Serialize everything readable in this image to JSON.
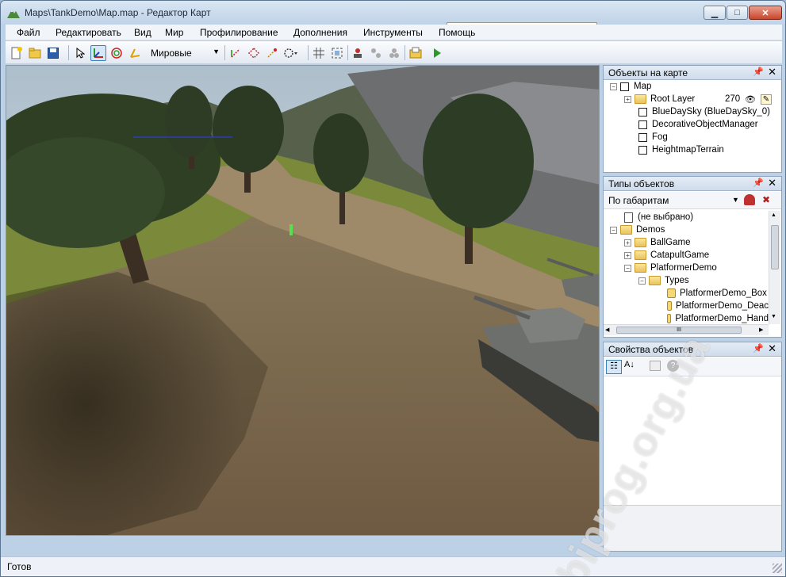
{
  "window": {
    "title": "Maps\\TankDemo\\Map.map - Редактор Карт",
    "minimize_glyph": "▁",
    "maximize_glyph": "□",
    "close_glyph": "✕"
  },
  "menu": [
    "Файл",
    "Редактировать",
    "Вид",
    "Мир",
    "Профилирование",
    "Дополнения",
    "Инструменты",
    "Помощь"
  ],
  "toolbar": {
    "coord_mode": "Мировые",
    "icons": [
      "new-file-icon",
      "open-folder-icon",
      "save-icon",
      "select-arrow-icon",
      "move-gizmo-icon",
      "rotate-gizmo-icon",
      "scale-gizmo-icon",
      "snap-move-icon",
      "snap-rotate-icon",
      "snap-scale-icon",
      "snap-align-icon",
      "grid-icon",
      "focus-icon",
      "create-object-icon",
      "clone-icon",
      "group-icon",
      "properties-icon",
      "play-icon"
    ]
  },
  "objects_panel": {
    "title": "Объекты на карте",
    "items": [
      {
        "label": "Map"
      },
      {
        "label": "Root Layer",
        "count": "270"
      },
      {
        "label": "BlueDaySky (BlueDaySky_0)"
      },
      {
        "label": "DecorativeObjectManager"
      },
      {
        "label": "Fog"
      },
      {
        "label": "HeightmapTerrain"
      }
    ]
  },
  "types_panel": {
    "title": "Типы объектов",
    "filter": "По габаритам",
    "items": [
      {
        "label": "(не выбрано)"
      },
      {
        "label": "Demos"
      },
      {
        "label": "BallGame"
      },
      {
        "label": "CatapultGame"
      },
      {
        "label": "PlatformerDemo"
      },
      {
        "label": "Types"
      },
      {
        "label": "PlatformerDemo_Box"
      },
      {
        "label": "PlatformerDemo_Deac"
      },
      {
        "label": "PlatformerDemo_Hand"
      }
    ],
    "hscroll_grip": "III"
  },
  "properties_panel": {
    "title": "Свойства объектов"
  },
  "status": {
    "text": "Готов"
  },
  "watermark": "biprog.org.ua",
  "colors": {
    "accent": "#3c7fb1",
    "grass": "#7d8a3c",
    "dirt": "#8a7456"
  }
}
